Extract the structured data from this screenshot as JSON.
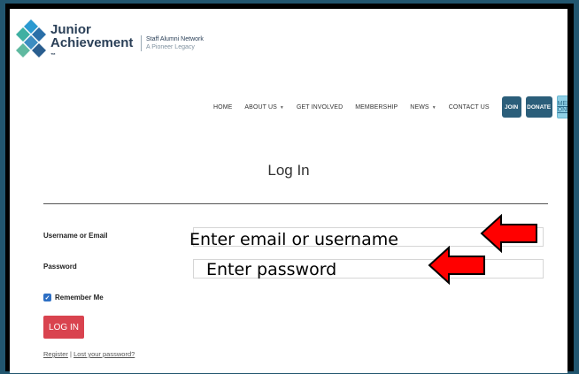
{
  "header": {
    "logo_line1": "Junior",
    "logo_line2": "Achievement",
    "logo_tm": "™",
    "network_name": "Staff Alumni Network",
    "tagline": "A Pioneer Legacy"
  },
  "nav": {
    "items": [
      "HOME",
      "ABOUT US",
      "GET INVOLVED",
      "MEMBERSHIP",
      "NEWS",
      "CONTACT US"
    ],
    "join": "JOIN",
    "donate": "DONATE",
    "members": "MEMBERS ONLY"
  },
  "form": {
    "title": "Log In",
    "username_label": "Username or Email",
    "password_label": "Password",
    "remember_label": "Remember Me",
    "login_button": "LOG IN",
    "register_link": "Register",
    "separator": "|",
    "lost_password_link": "Lost your password?"
  },
  "annotations": {
    "username_hint": "Enter email or username",
    "password_hint": "Enter password"
  },
  "colors": {
    "arrow": "#ff0000",
    "brand": "#2b5e7a",
    "login": "#d9434f"
  }
}
